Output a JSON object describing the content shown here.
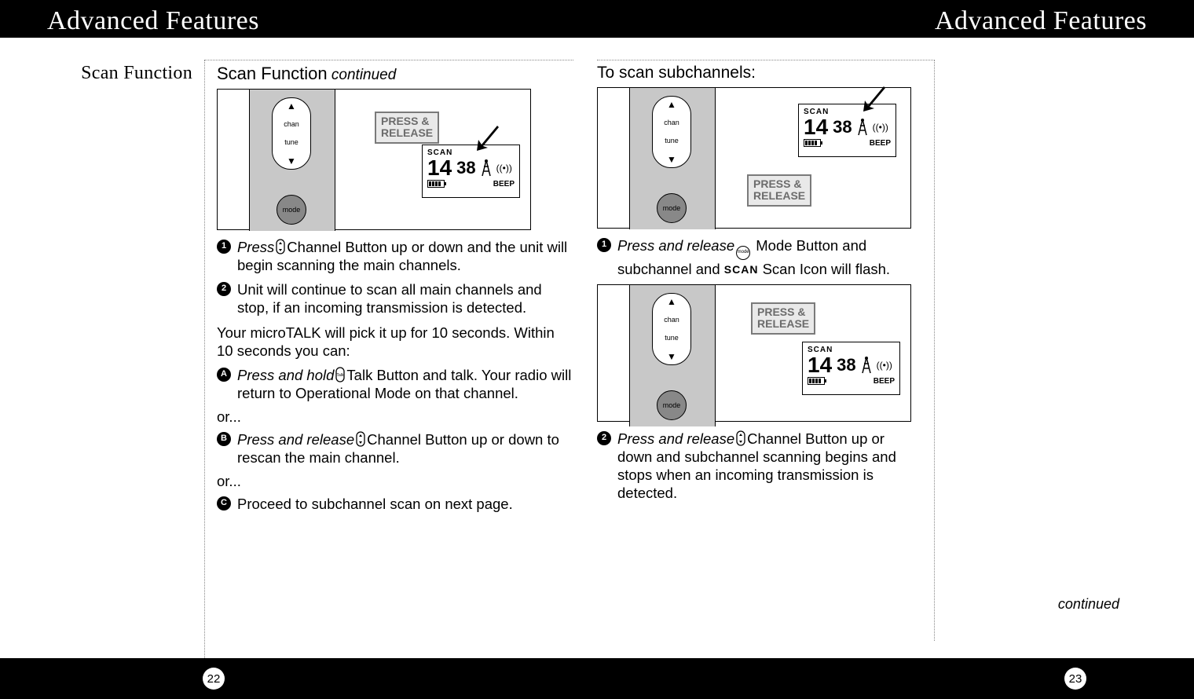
{
  "header": {
    "left": "Advanced Features",
    "right": "Advanced Features"
  },
  "left": {
    "sidebar_label": "Scan Function",
    "heading_main": "Scan Function",
    "heading_suffix": " continued",
    "illus": {
      "callout": "PRESS &\nRELEASE",
      "lcd": {
        "scan": "SCAN",
        "ch": "14",
        "sub": "38",
        "beep": "BEEP"
      },
      "panel_labels": {
        "up": "▲",
        "chan": "chan",
        "tune": "tune",
        "down": "▼"
      },
      "mode_label": "mode"
    },
    "steps": {
      "s1_pre": "Press",
      "s1_post": "Channel Button up or down and the unit will begin scanning the main channels.",
      "s2": "Unit will continue to scan all main channels and stop, if an incoming transmission is detected.",
      "mid_para": "Your microTALK will pick it up for 10 seconds. Within 10 seconds you can:",
      "sA_pre": "Press and hold",
      "sA_post": "Talk Button and talk.  Your radio will return to Operational Mode on that channel.",
      "or": "or...",
      "sB_pre": "Press and release",
      "sB_post": "Channel Button up or down to rescan the main channel.",
      "sC": "Proceed to subchannel scan on next page."
    }
  },
  "right": {
    "heading": "To scan subchannels:",
    "illus1": {
      "lcd": {
        "scan": "SCAN",
        "ch": "14",
        "sub": "38",
        "beep": "BEEP"
      },
      "callout": "PRESS &\nRELEASE",
      "panel_labels": {
        "up": "▲",
        "chan": "chan",
        "tune": "tune",
        "down": "▼"
      },
      "mode_label": "mode"
    },
    "step1_pre": "Press and release",
    "step1_mid": " Mode Button and subchannel and ",
    "step1_scanword": "SCAN",
    "step1_post": "  Scan Icon will flash.",
    "illus2": {
      "callout": "PRESS &\nRELEASE",
      "lcd": {
        "scan": "SCAN",
        "ch": "14",
        "sub": "38",
        "beep": "BEEP"
      },
      "panel_labels": {
        "up": "▲",
        "chan": "chan",
        "tune": "tune",
        "down": "▼"
      },
      "mode_label": "mode"
    },
    "step2_pre": "Press and release",
    "step2_post": "Channel Button up or down and subchannel scanning begins and stops when an incoming transmission is detected.",
    "continued": "continued"
  },
  "footer": {
    "left_page": "22",
    "right_page": "23"
  }
}
